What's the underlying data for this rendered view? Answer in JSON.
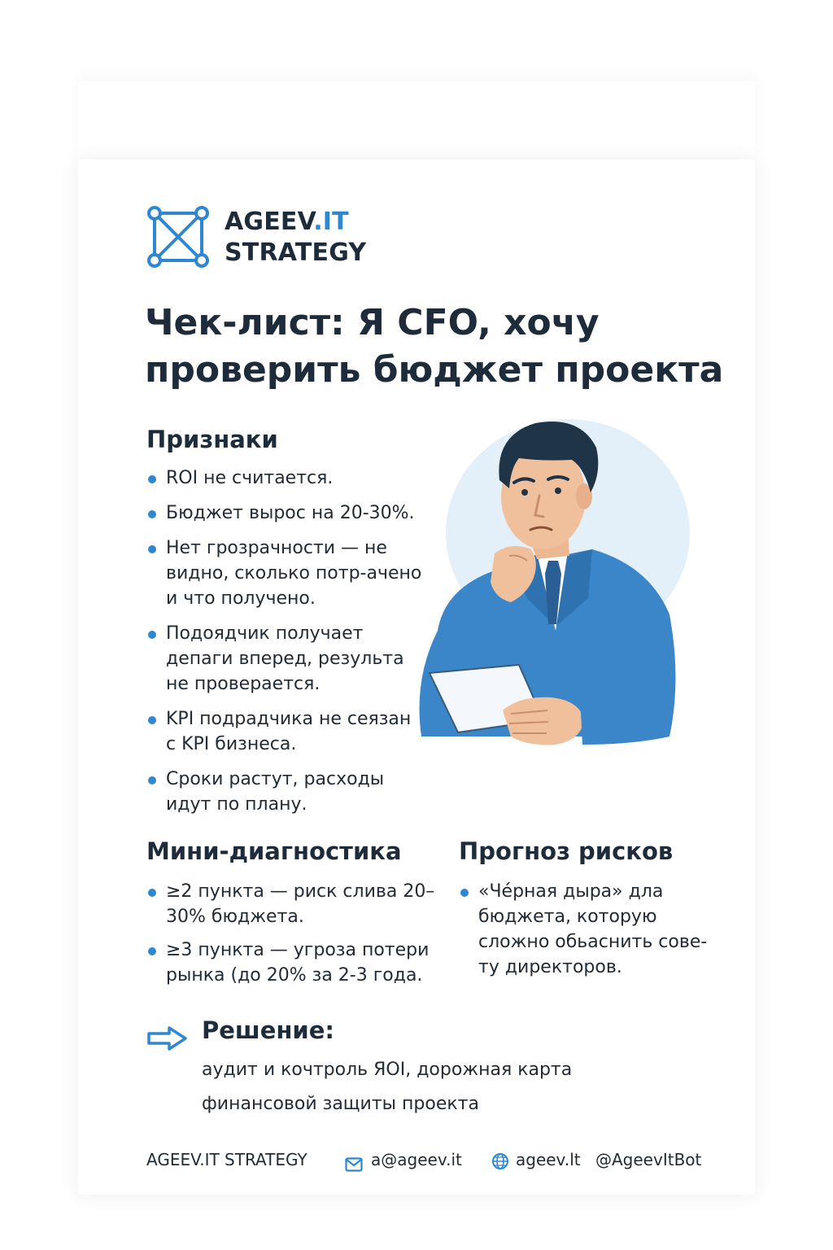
{
  "brand": {
    "name_part1": "AGEEV",
    "name_part2": ".IT",
    "name_line2": "STRATEGY",
    "accent_color": "#2f87cf",
    "logo_icon": "network-square-icon"
  },
  "title": "Чек-лист: Я CFO, хочу проверить бюджет проекта",
  "signs": {
    "heading": "Признаки",
    "items": [
      "ROI не считается.",
      "Бюджет вырос на 20-30%.",
      "Нет грозрачности — не видно, сколько потр-ачено и что получено.",
      "Подоядчик получает депаги вперед, результа не проверается.",
      "KPI подрадчика не сеязан с KPI бизнеса.",
      "Сроки растут, расходы идут по плану."
    ]
  },
  "illustration": {
    "subject": "thinking-businessman-with-document"
  },
  "diagnostics": {
    "heading": "Мини-диагностика",
    "items": [
      "≥2 пункта — риск слива 20–30% бюджета.",
      "≥3 пункта — угроза потери рынка (до 20% за 2-3 года."
    ]
  },
  "risks": {
    "heading": "Прогноз рисков",
    "items": [
      "«Че́рная дыра» дла бюджета, которую сложно обьаснить сове-ту директоров."
    ]
  },
  "solution": {
    "heading": "Решение:",
    "text": "аудит и кочтроль ЯOI, дорожная карта финансовой защиты проекта",
    "icon": "arrow-right-icon"
  },
  "footer": {
    "brand": "AGEEV.IT STRATEGY",
    "email": "a@ageev.it",
    "website": "ageev.lt",
    "bot": "@AgeevItBot",
    "email_icon": "mail-icon",
    "website_icon": "globe-icon"
  }
}
